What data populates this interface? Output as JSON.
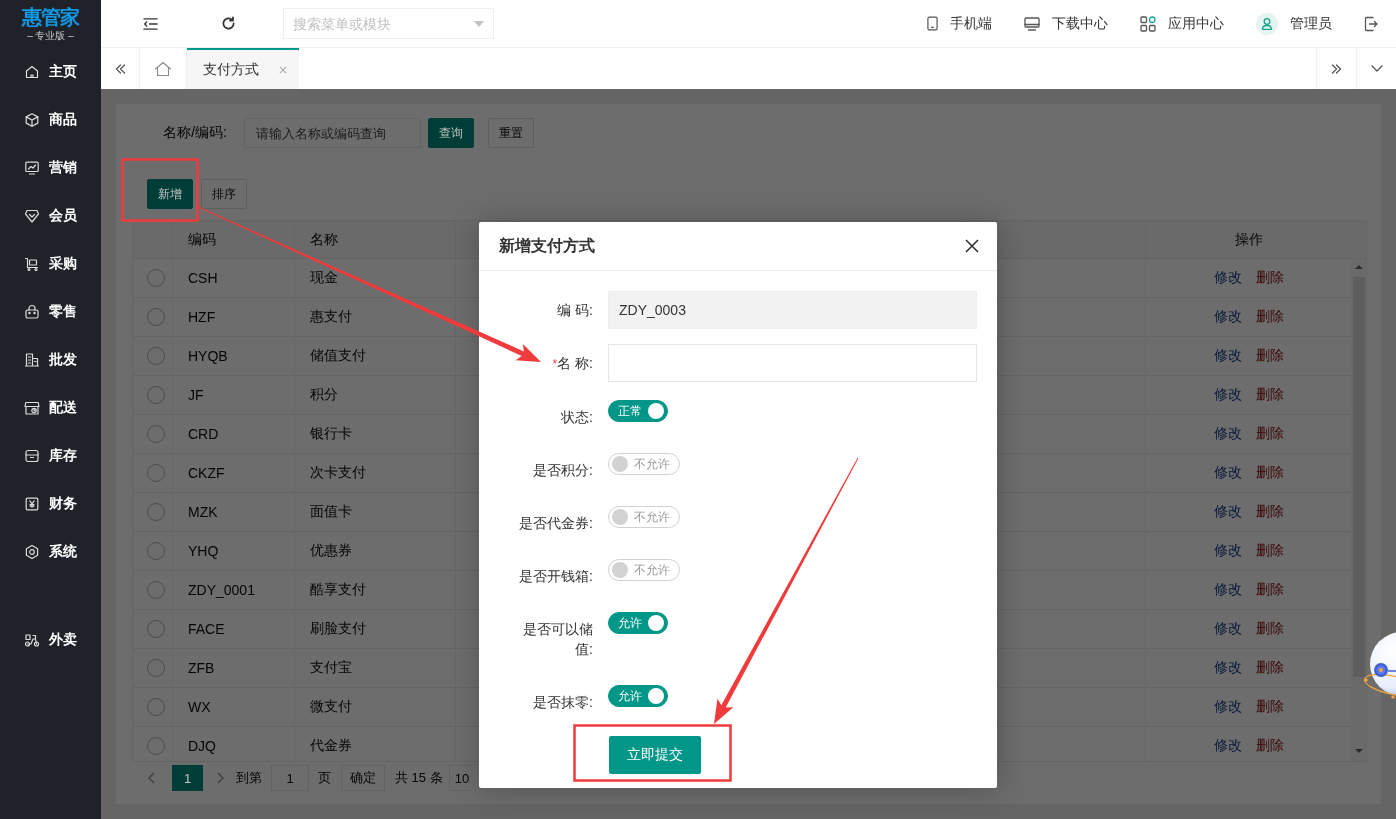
{
  "logo": {
    "name": "惠管家",
    "edition": "– 专业版 –"
  },
  "sidebar": {
    "items": [
      {
        "label": "主页",
        "selected": false
      },
      {
        "label": "商品",
        "selected": false
      },
      {
        "label": "营销",
        "selected": false
      },
      {
        "label": "会员",
        "selected": false
      },
      {
        "label": "采购",
        "selected": false
      },
      {
        "label": "零售",
        "selected": false
      },
      {
        "label": "批发",
        "selected": false
      },
      {
        "label": "配送",
        "selected": false
      },
      {
        "label": "库存",
        "selected": false
      },
      {
        "label": "财务",
        "selected": false
      },
      {
        "label": "系统",
        "selected": false
      }
    ],
    "bottom_items": [
      {
        "label": "外卖",
        "selected": false
      }
    ]
  },
  "header": {
    "search": {
      "placeholder": "搜索菜单或模块"
    },
    "links": [
      "手机端",
      "下载中心",
      "应用中心"
    ],
    "user": "管理员"
  },
  "tabs": [
    {
      "label": "支付方式",
      "selected": true
    }
  ],
  "page": {
    "filter": {
      "label": "名称/编码:",
      "placeholder": "请输入名称或编码查询",
      "buttons": [
        {
          "label": "查询",
          "kind": "primary"
        },
        {
          "label": "重置",
          "kind": "default"
        }
      ]
    },
    "toolbar": [
      {
        "label": "新增",
        "kind": "primary"
      },
      {
        "label": "排序",
        "kind": "default"
      }
    ],
    "table": {
      "columns": [
        "编码",
        "名称",
        "操作"
      ],
      "rows": [
        {
          "code": "CSH",
          "name": "现金",
          "selected": false,
          "actions": [
            {
              "label": "修改",
              "kind": "edit"
            },
            {
              "label": "删除",
              "kind": "delete"
            }
          ]
        },
        {
          "code": "HZF",
          "name": "惠支付",
          "selected": false,
          "actions": [
            {
              "label": "修改",
              "kind": "edit"
            },
            {
              "label": "删除",
              "kind": "delete"
            }
          ]
        },
        {
          "code": "HYQB",
          "name": "储值支付",
          "selected": false,
          "actions": [
            {
              "label": "修改",
              "kind": "edit"
            },
            {
              "label": "删除",
              "kind": "delete"
            }
          ]
        },
        {
          "code": "JF",
          "name": "积分",
          "selected": false,
          "actions": [
            {
              "label": "修改",
              "kind": "edit"
            },
            {
              "label": "删除",
              "kind": "delete"
            }
          ]
        },
        {
          "code": "CRD",
          "name": "银行卡",
          "selected": false,
          "actions": [
            {
              "label": "修改",
              "kind": "edit"
            },
            {
              "label": "删除",
              "kind": "delete"
            }
          ]
        },
        {
          "code": "CKZF",
          "name": "次卡支付",
          "selected": false,
          "actions": [
            {
              "label": "修改",
              "kind": "edit"
            },
            {
              "label": "删除",
              "kind": "delete"
            }
          ]
        },
        {
          "code": "MZK",
          "name": "面值卡",
          "selected": false,
          "actions": [
            {
              "label": "修改",
              "kind": "edit"
            },
            {
              "label": "删除",
              "kind": "delete"
            }
          ]
        },
        {
          "code": "YHQ",
          "name": "优惠券",
          "selected": false,
          "actions": [
            {
              "label": "修改",
              "kind": "edit"
            },
            {
              "label": "删除",
              "kind": "delete"
            }
          ]
        },
        {
          "code": "ZDY_0001",
          "name": "酷享支付",
          "selected": false,
          "actions": [
            {
              "label": "修改",
              "kind": "edit"
            },
            {
              "label": "删除",
              "kind": "delete"
            }
          ]
        },
        {
          "code": "FACE",
          "name": "刷脸支付",
          "selected": false,
          "actions": [
            {
              "label": "修改",
              "kind": "edit"
            },
            {
              "label": "删除",
              "kind": "delete"
            }
          ]
        },
        {
          "code": "ZFB",
          "name": "支付宝",
          "selected": false,
          "actions": [
            {
              "label": "修改",
              "kind": "edit"
            },
            {
              "label": "删除",
              "kind": "delete"
            }
          ]
        },
        {
          "code": "WX",
          "name": "微支付",
          "selected": false,
          "actions": [
            {
              "label": "修改",
              "kind": "edit"
            },
            {
              "label": "删除",
              "kind": "delete"
            }
          ]
        },
        {
          "code": "DJQ",
          "name": "代金券",
          "selected": false,
          "actions": [
            {
              "label": "修改",
              "kind": "edit"
            },
            {
              "label": "删除",
              "kind": "delete"
            }
          ]
        }
      ]
    },
    "pagination": {
      "pages": [
        {
          "label": "1",
          "selected": true
        }
      ],
      "goto_label": "到第",
      "goto_value": "1",
      "page_unit": "页",
      "confirm": "确定",
      "total": "共 15 条",
      "page_size": "10"
    }
  },
  "dialog": {
    "title": "新增支付方式",
    "fields": [
      {
        "kind": "text",
        "label": "编 码:",
        "value": "ZDY_0003",
        "disabled": true
      },
      {
        "kind": "text",
        "label": "名 称:",
        "required_mark": "*",
        "disabled": false
      },
      {
        "kind": "switch",
        "label": "状态:",
        "on": true,
        "text": "正常"
      },
      {
        "kind": "switch",
        "label": "是否积分:",
        "on": false,
        "text": "不允许"
      },
      {
        "kind": "switch",
        "label": "是否代金券:",
        "on": false,
        "text": "不允许"
      },
      {
        "kind": "switch",
        "label": "是否开钱箱:",
        "on": false,
        "text": "不允许"
      },
      {
        "kind": "switch",
        "label": "是否可以储值:",
        "on": true,
        "text": "允许"
      },
      {
        "kind": "switch",
        "label": "是否抹零:",
        "on": true,
        "text": "允许"
      }
    ],
    "submit": "立即提交"
  }
}
